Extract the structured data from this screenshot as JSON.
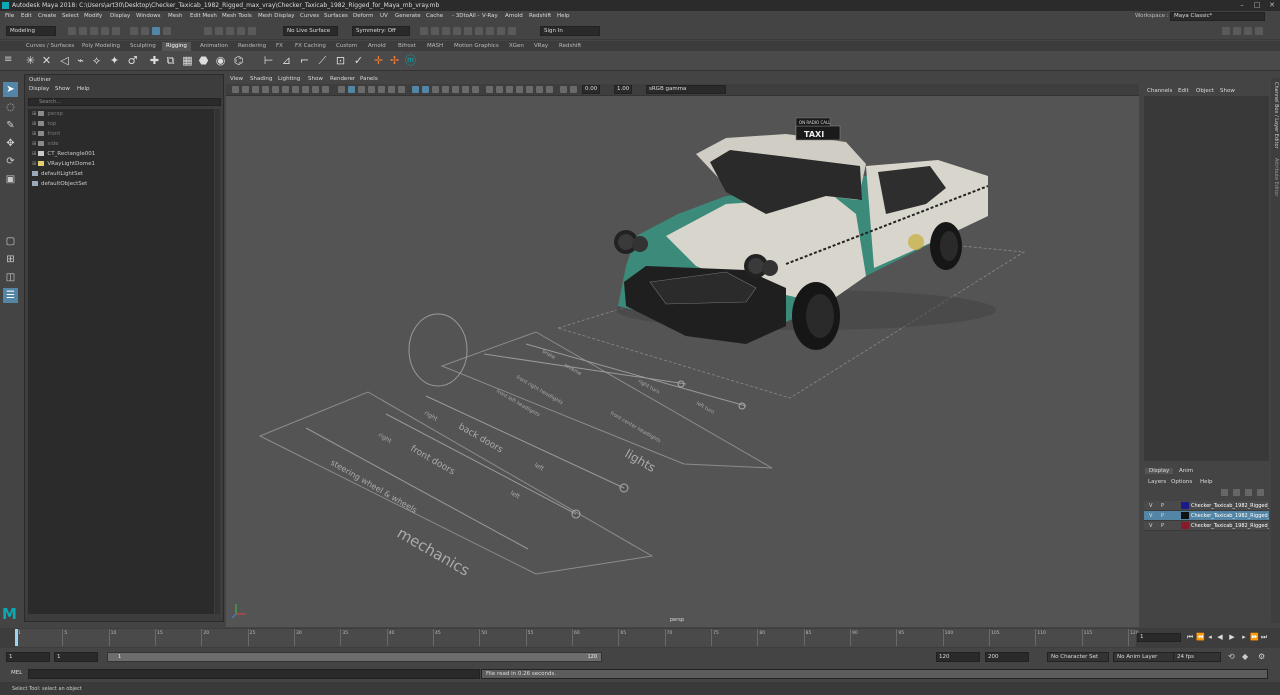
{
  "window": {
    "title": "Autodesk Maya 2018: C:\\Users\\art30\\Desktop\\Checker_Taxicab_1982_Rigged_max_vray\\Checker_Taxicab_1982_Rigged_for_Maya_mb_vray.mb",
    "minimize": "–",
    "maximize": "□",
    "close": "✕"
  },
  "menubar": {
    "items": [
      "File",
      "Edit",
      "Create",
      "Select",
      "Modify",
      "Display",
      "Windows",
      "Mesh",
      "Edit Mesh",
      "Mesh Tools",
      "Mesh Display",
      "Curves",
      "Surfaces",
      "Deform",
      "UV",
      "Generate",
      "Cache",
      "- 3DtoAll -",
      "V-Ray",
      "Arnold",
      "Redshift",
      "Help"
    ],
    "workspace_label": "Workspace :",
    "workspace_value": "Maya Classic*"
  },
  "statusline": {
    "mode": "Modeling",
    "live_surface": "No Live Surface",
    "symmetry": "Symmetry: Off",
    "sign_in": "Sign In"
  },
  "shelf": {
    "tabs": [
      "Curves / Surfaces",
      "Poly Modeling",
      "Sculpting",
      "Rigging",
      "Animation",
      "Rendering",
      "FX",
      "FX Caching",
      "Custom",
      "Arnold",
      "Bifrost",
      "MASH",
      "Motion Graphics",
      "XGen",
      "VRay",
      "Redshift"
    ],
    "active_tab": "Rigging",
    "icons": [
      "joint-icon",
      "ik-handle-icon",
      "ik-spline-icon",
      "insert-joint-icon",
      "mirror-joint-icon",
      "orient-joint-icon",
      "bind-skin-icon",
      "paint-weights-icon",
      "smooth-bind-icon",
      "lattice-icon",
      "cluster-icon",
      "blendshape-icon",
      "wrap-icon",
      "point-constraint-icon",
      "orient-constraint-icon",
      "parent-constraint-icon",
      "aim-constraint-icon",
      "scale-constraint-icon",
      "pole-vector-icon",
      "hik-icon",
      "quick-rig-icon",
      "mash-icon"
    ]
  },
  "outliner": {
    "title": "Outliner",
    "menus": [
      "Display",
      "Show",
      "Help"
    ],
    "search_placeholder": "Search...",
    "items": [
      {
        "label": "persp",
        "dim": true,
        "icon": "camera-icon"
      },
      {
        "label": "top",
        "dim": true,
        "icon": "camera-icon"
      },
      {
        "label": "front",
        "dim": true,
        "icon": "camera-icon"
      },
      {
        "label": "side",
        "dim": true,
        "icon": "camera-icon"
      },
      {
        "label": "CT_Rectangle001",
        "dim": false,
        "icon": "transform-icon"
      },
      {
        "label": "VRayLightDome1",
        "dim": false,
        "icon": "light-icon"
      },
      {
        "label": "defaultLightSet",
        "dim": false,
        "icon": "set-icon"
      },
      {
        "label": "defaultObjectSet",
        "dim": false,
        "icon": "set-icon"
      }
    ]
  },
  "viewport": {
    "menus": [
      "View",
      "Shading",
      "Lighting",
      "Show",
      "Renderer",
      "Panels"
    ],
    "exposure": "0.00",
    "gamma": "1.00",
    "color_space": "sRGB gamma",
    "camera": "persp",
    "sign_top": "ON RADIO CALL",
    "sign_main": "TAXI",
    "rig_labels": [
      "mechanics",
      "steering wheel & wheels",
      "front doors",
      "back doors",
      "left",
      "right",
      "left",
      "right",
      "lights",
      "front left headlights",
      "front right headlights",
      "front center headlights",
      "left turn",
      "right turn",
      "brake",
      "reverse"
    ]
  },
  "channelbox": {
    "menus": [
      "Channels",
      "Edit",
      "Object",
      "Show"
    ],
    "sidetabs": [
      "Channel Box / Layer Editor",
      "Attribute Editor"
    ]
  },
  "layers": {
    "tabs": [
      "Display",
      "Anim"
    ],
    "menus": [
      "Layers",
      "Options",
      "Help"
    ],
    "rows": [
      {
        "v": "V",
        "p": "P",
        "color": "#1a1a8a",
        "name": "Checker_Taxicab_1982_Rigged_Controllers",
        "selected": false
      },
      {
        "v": "V",
        "p": "P",
        "color": "#111111",
        "name": "Checker_Taxicab_1982_Rigged_Helpers",
        "selected": true
      },
      {
        "v": "V",
        "p": "P",
        "color": "#8a1a2a",
        "name": "Checker_Taxicab_1982_Rigged_Geometry",
        "selected": false
      }
    ]
  },
  "timeslider": {
    "ticks": [
      "1",
      "5",
      "10",
      "15",
      "20",
      "25",
      "30",
      "35",
      "40",
      "45",
      "50",
      "55",
      "60",
      "65",
      "70",
      "75",
      "80",
      "85",
      "90",
      "95",
      "100",
      "105",
      "110",
      "115",
      "120"
    ],
    "current_frame": "1",
    "start_fraction": 0.0
  },
  "range": {
    "start": "1",
    "anim_start": "1",
    "range_start_label": "1",
    "range_end_label": "120",
    "end": "120",
    "anim_end": "200",
    "character_set": "No Character Set",
    "anim_layer": "No Anim Layer",
    "fps": "24 fps"
  },
  "command": {
    "label": "MEL",
    "output": "File read in  0.26 seconds."
  },
  "helpline": {
    "text": "Select Tool: select an object"
  },
  "colors": {
    "accent": "#5285a6",
    "maya_logo": "#0aa9b5",
    "taxi_green": "#3c8a7a",
    "taxi_white": "#d8d6cc"
  }
}
